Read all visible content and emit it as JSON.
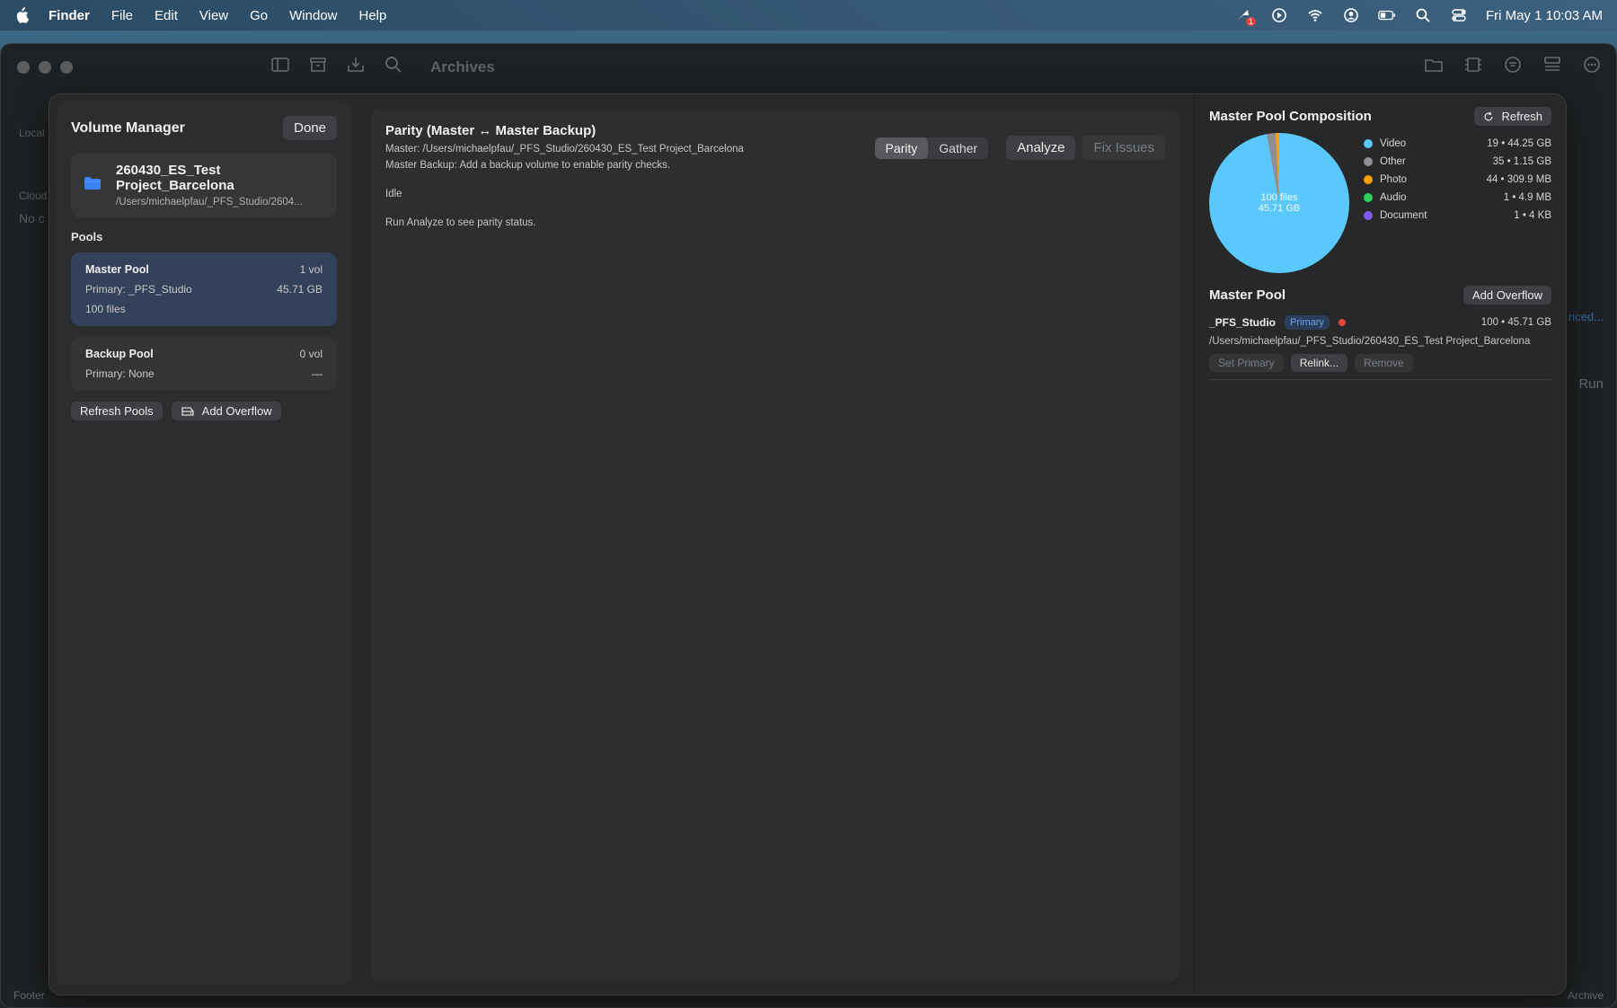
{
  "menubar": {
    "app": "Finder",
    "items": [
      "File",
      "Edit",
      "View",
      "Go",
      "Window",
      "Help"
    ],
    "notification_badge": "1",
    "clock": "Fri May 1  10:03 AM"
  },
  "finder": {
    "title": "Archives",
    "sidebar_local": "Local",
    "sidebar_cloud": "Cloud",
    "sidebar_no": "No c",
    "footer": "Footer",
    "archive_label": "Archive",
    "run_label": "Run",
    "link_text": "nced..."
  },
  "volume_manager": {
    "title": "Volume Manager",
    "done_label": "Done",
    "project": {
      "name": "260430_ES_Test Project_Barcelona",
      "path": "/Users/michaelpfau/_PFS_Studio/2604..."
    },
    "pools_label": "Pools",
    "pools": [
      {
        "name": "Master Pool",
        "vol": "1 vol",
        "primary": "Primary: _PFS_Studio",
        "size": "45.71 GB",
        "files": "100 files"
      },
      {
        "name": "Backup Pool",
        "vol": "0 vol",
        "primary": "Primary: None",
        "size": "—"
      }
    ],
    "refresh_pools_label": "Refresh Pools",
    "add_overflow_label": "Add Overflow"
  },
  "parity": {
    "title": "Parity (Master ↔ Master Backup)",
    "master_line": "Master: /Users/michaelpfau/_PFS_Studio/260430_ES_Test Project_Barcelona",
    "backup_line": "Master Backup: Add a backup volume to enable parity checks.",
    "status": "Idle",
    "hint": "Run Analyze to see parity status.",
    "segments": [
      "Parity",
      "Gather"
    ],
    "analyze_label": "Analyze",
    "fix_label": "Fix Issues"
  },
  "composition": {
    "title": "Master Pool Composition",
    "refresh_label": "Refresh",
    "center_files": "100 files",
    "center_size": "45.71 GB",
    "legend": [
      {
        "label": "Video",
        "value": "19 • 44.25 GB",
        "color": "#5ac8fa"
      },
      {
        "label": "Other",
        "value": "35 • 1.15 GB",
        "color": "#8e8e93"
      },
      {
        "label": "Photo",
        "value": "44 • 309.9 MB",
        "color": "#ff9f0a"
      },
      {
        "label": "Audio",
        "value": "1 • 4.9 MB",
        "color": "#30d158"
      },
      {
        "label": "Document",
        "value": "1 • 4 KB",
        "color": "#7d5cf0"
      }
    ]
  },
  "master_pool": {
    "title": "Master Pool",
    "add_overflow_label": "Add Overflow",
    "volume": {
      "name": "_PFS_Studio",
      "badge": "Primary",
      "stats": "100 • 45.71 GB",
      "path": "/Users/michaelpfau/_PFS_Studio/260430_ES_Test Project_Barcelona"
    },
    "set_primary_label": "Set Primary",
    "relink_label": "Relink...",
    "remove_label": "Remove"
  }
}
